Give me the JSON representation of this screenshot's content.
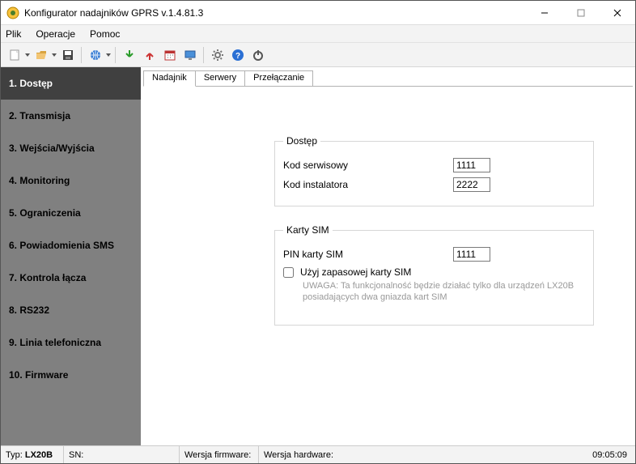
{
  "window": {
    "title": "Konfigurator nadajników GPRS v.1.4.81.3"
  },
  "menu": {
    "items": [
      "Plik",
      "Operacje",
      "Pomoc"
    ]
  },
  "toolbar": {
    "icons": [
      "new-icon",
      "open-icon",
      "save-icon",
      "globe-icon",
      "download-icon",
      "upload-icon",
      "calendar-icon",
      "monitor-icon",
      "gear-icon",
      "help-icon",
      "power-icon"
    ]
  },
  "sidebar": {
    "items": [
      "1. Dostęp",
      "2. Transmisja",
      "3. Wejścia/Wyjścia",
      "4. Monitoring",
      "5. Ograniczenia",
      "6. Powiadomienia SMS",
      "7. Kontrola łącza",
      "8. RS232",
      "9. Linia telefoniczna",
      "10. Firmware"
    ],
    "selected_index": 0
  },
  "tabs": {
    "items": [
      "Nadajnik",
      "Serwery",
      "Przełączanie"
    ],
    "selected_index": 0
  },
  "form": {
    "dostep": {
      "legend": "Dostęp",
      "service_label": "Kod serwisowy",
      "service_value": "1111",
      "installer_label": "Kod instalatora",
      "installer_value": "2222"
    },
    "sim": {
      "legend": "Karty SIM",
      "pin_label": "PIN karty SIM",
      "pin_value": "1111",
      "backup_label": "Użyj zapasowej karty SIM",
      "backup_checked": false,
      "note": "UWAGA: Ta funkcjonalność będzie działać tylko dla urządzeń LX20B posiadających dwa gniazda kart SIM"
    }
  },
  "statusbar": {
    "type_label": "Typ:",
    "type_value": "LX20B",
    "sn_label": "SN:",
    "fw_label": "Wersja firmware:",
    "hw_label": "Wersja hardware:",
    "clock": "09:05:09"
  }
}
